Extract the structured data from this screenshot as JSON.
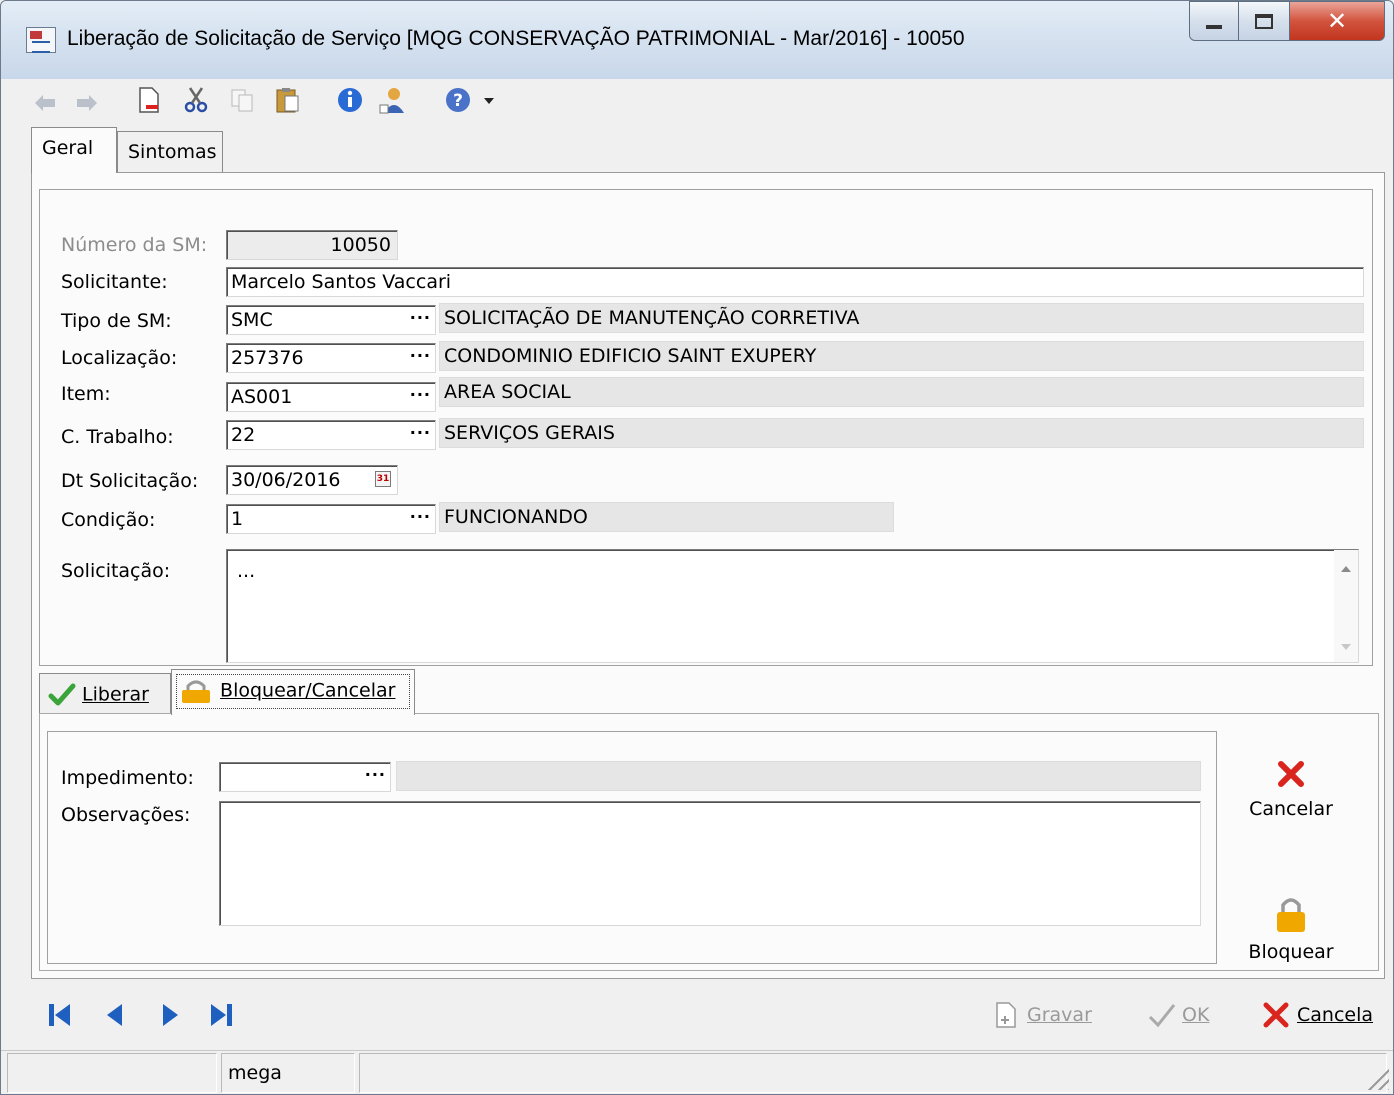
{
  "window": {
    "title": "Liberação de Solicitação de Serviço [MQG CONSERVAÇÃO PATRIMONIAL - Mar/2016]  - 10050"
  },
  "toolbar": {
    "icons": [
      "undo-icon",
      "redo-icon",
      "new-document-icon",
      "cut-icon",
      "copy-icon",
      "paste-icon",
      "info-icon",
      "user-icon",
      "help-icon"
    ]
  },
  "tabs": {
    "geral": "Geral",
    "sintomas": "Sintomas"
  },
  "form": {
    "numero_label": "Número da SM:",
    "numero_value": "10050",
    "solicitante_label": "Solicitante:",
    "solicitante_value": "Marcelo Santos Vaccari",
    "tipo_label": "Tipo de SM:",
    "tipo_code": "SMC",
    "tipo_desc": "SOLICITAÇÃO DE MANUTENÇÃO CORRETIVA",
    "localizacao_label": "Localização:",
    "localizacao_code": "257376",
    "localizacao_desc": "CONDOMINIO EDIFICIO SAINT EXUPERY",
    "item_label": "Item:",
    "item_code": "AS001",
    "item_desc": "AREA SOCIAL",
    "trabalho_label": "C. Trabalho:",
    "trabalho_code": "22",
    "trabalho_desc": "SERVIÇOS GERAIS",
    "dt_label": "Dt Solicitação:",
    "dt_value": "30/06/2016",
    "condicao_label": "Condição:",
    "condicao_code": "1",
    "condicao_desc": "FUNCIONANDO",
    "solicitacao_label": "Solicitação:",
    "solicitacao_value": "...",
    "ellipsis": "···"
  },
  "subtabs": {
    "liberar": "Liberar",
    "bloquear": "Bloquear/Cancelar"
  },
  "block": {
    "impedimento_label": "Impedimento:",
    "impedimento_code": "",
    "impedimento_desc": "",
    "observacoes_label": "Observações:",
    "observacoes_value": "",
    "cancelar": "Cancelar",
    "bloquear": "Bloquear"
  },
  "bottom": {
    "gravar": "Gravar",
    "ok": "OK",
    "cancela": "Cancela"
  },
  "status": {
    "cell1": "",
    "user": "mega",
    "cell3": ""
  },
  "colors": {
    "check_green": "#3aa33a",
    "cancel_red": "#d9251d",
    "lock_orange": "#f0a800",
    "nav_blue": "#1f5fbf"
  }
}
